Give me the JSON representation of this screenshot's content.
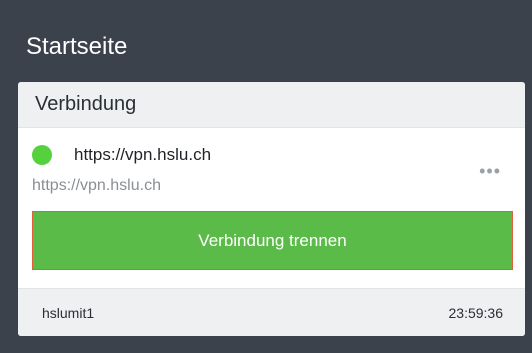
{
  "header": {
    "title": "Startseite"
  },
  "card": {
    "title": "Verbindung",
    "connection": {
      "name": "https://vpn.hslu.ch",
      "url": "https://vpn.hslu.ch",
      "status_color": "#55d13d",
      "more_label": "•••",
      "disconnect_label": "Verbindung trennen"
    },
    "footer": {
      "user": "hslumit1",
      "time": "23:59:36"
    }
  },
  "colors": {
    "background": "#3c424b",
    "button": "#5bbb49",
    "button_border": "#e25f3b"
  }
}
